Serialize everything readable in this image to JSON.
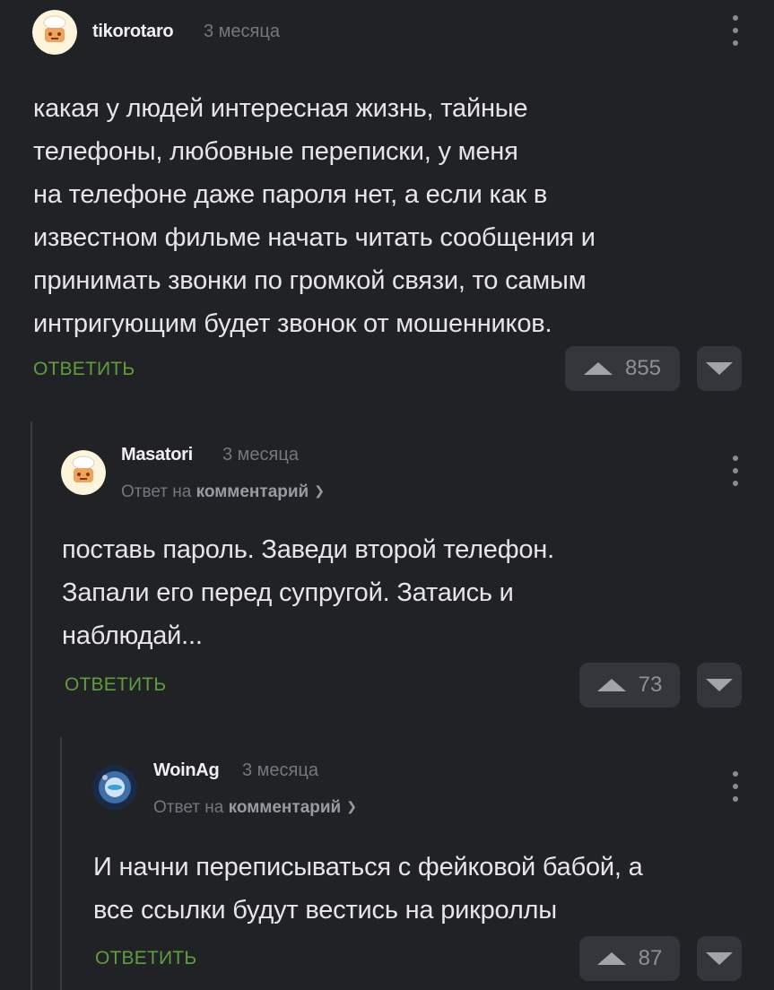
{
  "comments": [
    {
      "author": "tikorotaro",
      "time": "3 месяца",
      "text": "какая у людей интересная жизнь, тайные\nтелефоны, любовные переписки, у меня\nна телефоне даже пароля нет, а если как в\nизвестном фильме начать читать сообщения и\nпринимать звонки по громкой связи, то самым\nинтригующим будет звонок от мошенников.",
      "reply_label": "ОТВЕТИТЬ",
      "rating": "855"
    },
    {
      "author": "Masatori",
      "time": "3 месяца",
      "reply_prefix": "Ответ на",
      "reply_target": "комментарий",
      "text": "поставь пароль. Заведи второй телефон.\nЗапали его перед супругой. Затаись и\nнаблюдай...",
      "reply_label": "ОТВЕТИТЬ",
      "rating": "73"
    },
    {
      "author": "WoinAg",
      "time": "3 месяца",
      "reply_prefix": "Ответ на",
      "reply_target": "комментарий",
      "text": "И начни переписываться с фейковой бабой, а\nвсе ссылки будут вестись на рикроллы",
      "reply_label": "ОТВЕТИТЬ",
      "rating": "87"
    }
  ],
  "colors": {
    "background": "#212226",
    "reply_link": "#5f9e3a",
    "vote_button": "#35363b"
  },
  "icons": {
    "vote_up": "triangle-up-icon",
    "vote_down": "triangle-down-icon",
    "menu": "vertical-dots-icon",
    "expand": "chevron-down-icon"
  }
}
